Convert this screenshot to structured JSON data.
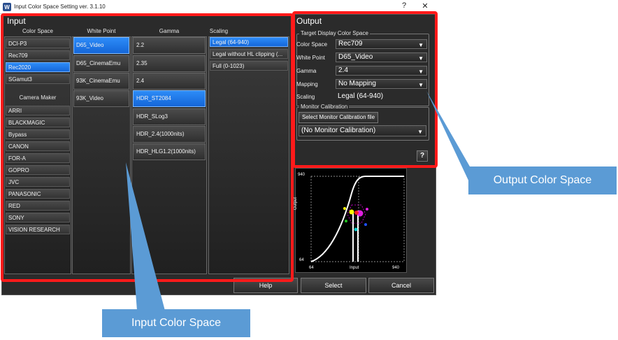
{
  "window": {
    "title": "Input Color Space Setting ver. 3.1.10",
    "minimize": "–",
    "help_glyph": "?",
    "close": "✕"
  },
  "input": {
    "title": "Input",
    "headers": {
      "color_space": "Color Space",
      "white_point": "White Point",
      "gamma": "Gamma",
      "scaling": "Scaling",
      "camera_maker": "Camera Maker"
    },
    "color_spaces": [
      "DCI-P3",
      "Rec709",
      "Rec2020",
      "SGamut3"
    ],
    "camera_makers": [
      "ARRI",
      "BLACKMAGIC",
      "Bypass",
      "CANON",
      "FOR-A",
      "GOPRO",
      "JVC",
      "PANASONIC",
      "RED",
      "SONY",
      "VISION RESEARCH"
    ],
    "white_points": [
      "D65_Video",
      "D65_CinemaEmu",
      "93K_CinemaEmu",
      "93K_Video"
    ],
    "gammas": [
      "2.2",
      "2.35",
      "2.4",
      "HDR_ST2084",
      "HDR_SLog3",
      "HDR_2.4(1000nits)",
      "HDR_HLG1.2(1000nits)"
    ],
    "scalings": [
      "Legal (64-940)",
      "Legal without HL clipping (...",
      "Full (0-1023)"
    ]
  },
  "output": {
    "title": "Output",
    "target_group": "Target Display Color Space",
    "labels": {
      "color_space": "Color Space",
      "white_point": "White Point",
      "gamma": "Gamma",
      "mapping": "Mapping",
      "scaling": "Scaling"
    },
    "values": {
      "color_space": "Rec709",
      "white_point": "D65_Video",
      "gamma": "2.4",
      "mapping": "No Mapping",
      "scaling": "Legal (64-940)"
    },
    "calibration_group": "Monitor Calibration",
    "select_calibration_button": "Select Monitor Calibration file",
    "calibration_value": "(No Monitor Calibration)",
    "help_button": "?"
  },
  "graph": {
    "y_top": "940",
    "y_bottom": "64",
    "y_label": "Output",
    "x_left": "64",
    "x_mid": "Input",
    "x_right": "940"
  },
  "buttons": {
    "help": "Help",
    "select": "Select",
    "cancel": "Cancel"
  },
  "callouts": {
    "output": "Output Color Space",
    "input": "Input Color Space"
  },
  "colors": {
    "accent": "#1e78f0",
    "highlight": "#ff1a1a",
    "callout": "#5b9bd5"
  }
}
